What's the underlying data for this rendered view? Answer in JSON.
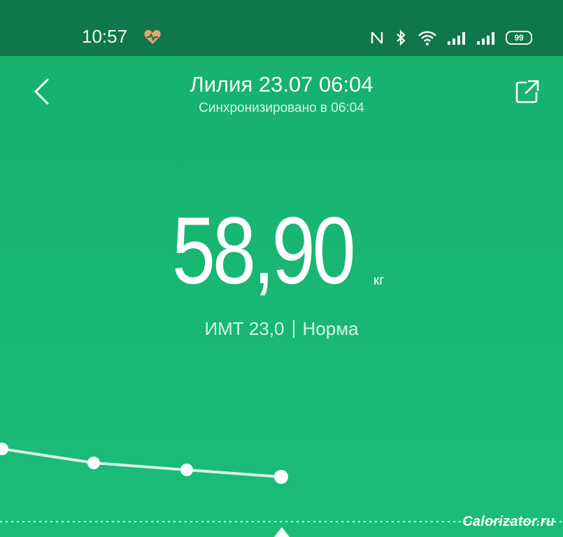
{
  "status_bar": {
    "time": "10:57",
    "battery": "99"
  },
  "header": {
    "title": "Лилия 23.07 06:04",
    "subtitle": "Синхронизировано в 06:04"
  },
  "measurement": {
    "weight": "58,90",
    "unit": "кг",
    "bmi": "ИМТ 23,0",
    "status": "Норма"
  },
  "chart_data": {
    "type": "line",
    "values": [
      59.1,
      59.0,
      58.95,
      58.9
    ]
  },
  "watermark": "Calorizator.ru",
  "colors": {
    "status_bar": "#10774a",
    "background": "#17b571",
    "text": "#ffffff"
  },
  "icons": [
    "heart-rate-icon",
    "nfc-icon",
    "bluetooth-icon",
    "wifi-icon",
    "signal-icon",
    "back-icon",
    "share-icon"
  ]
}
